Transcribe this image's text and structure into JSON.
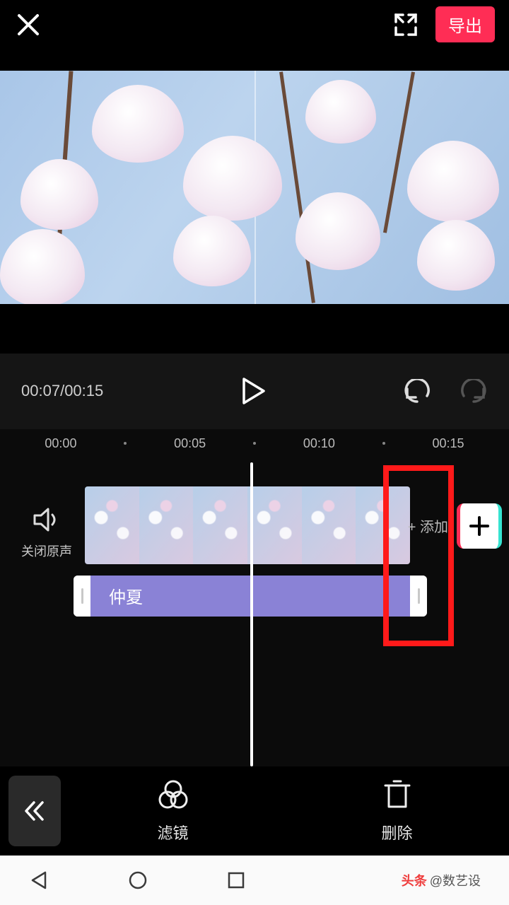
{
  "topbar": {
    "export_label": "导出"
  },
  "playback": {
    "current": "00:07",
    "total": "00:15"
  },
  "ruler": [
    "00:00",
    "00:05",
    "00:10",
    "00:15"
  ],
  "mute": {
    "label": "关闭原声"
  },
  "filter_clip": {
    "name": "仲夏"
  },
  "add": {
    "label": "+ 添加"
  },
  "tools": {
    "filter": "滤镜",
    "delete": "删除"
  },
  "credit": {
    "prefix": "头条",
    "author": "@数艺设"
  }
}
